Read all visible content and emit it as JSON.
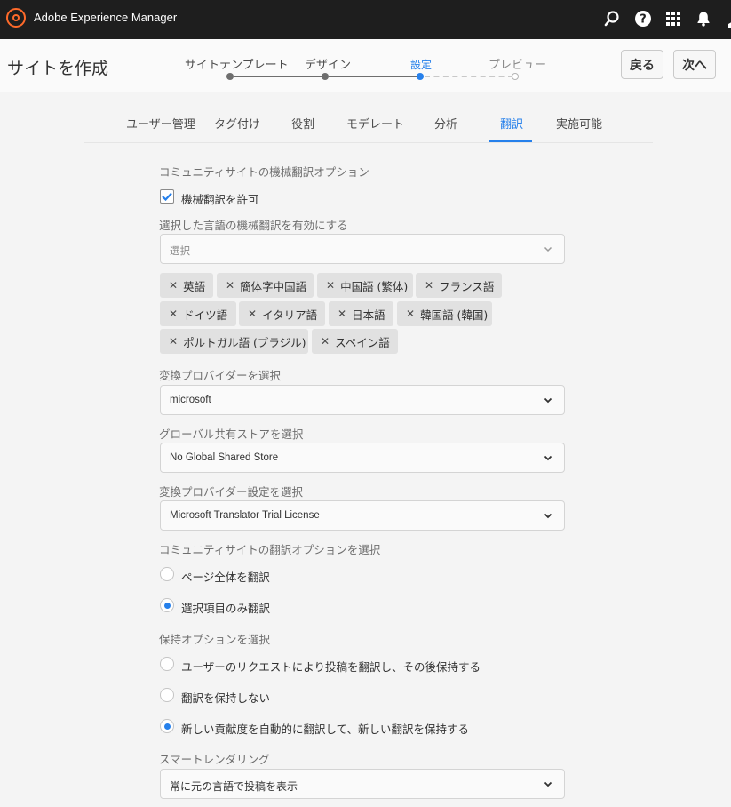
{
  "topbar": {
    "app_title": "Adobe Experience Manager",
    "icons": [
      "search-icon",
      "help-icon",
      "apps-icon",
      "bell-icon",
      "user-icon"
    ]
  },
  "header": {
    "page_title": "サイトを作成",
    "steps": [
      {
        "label": "サイトテンプレート",
        "state": "done"
      },
      {
        "label": "デザイン",
        "state": "done"
      },
      {
        "label": "設定",
        "state": "active"
      },
      {
        "label": "プレビュー",
        "state": "pending"
      }
    ],
    "back_label": "戻る",
    "next_label": "次へ"
  },
  "tabs": [
    {
      "label": "ユーザー管理"
    },
    {
      "label": "タグ付け"
    },
    {
      "label": "役割"
    },
    {
      "label": "モデレート"
    },
    {
      "label": "分析"
    },
    {
      "label": "翻訳",
      "active": true
    },
    {
      "label": "実施可能"
    }
  ],
  "form": {
    "mt_section_label": "コミュニティサイトの機械翻訳オプション",
    "allow_mt_label": "機械翻訳を許可",
    "allow_mt_checked": true,
    "languages_label": "選択した言語の機械翻訳を有効にする",
    "languages_placeholder": "選択",
    "language_tags": [
      "英語",
      "簡体字中国語",
      "中国語 (繁体)",
      "フランス語",
      "ドイツ語",
      "イタリア語",
      "日本語",
      "韓国語 (韓国)",
      "ポルトガル語 (ブラジル)",
      "スペイン語"
    ],
    "provider_label": "変換プロバイダーを選択",
    "provider_value": "microsoft",
    "store_label": "グローバル共有ストアを選択",
    "store_value": "No Global Shared Store",
    "provider_config_label": "変換プロバイダー設定を選択",
    "provider_config_value": "Microsoft Translator Trial License",
    "translate_options_label": "コミュニティサイトの翻訳オプションを選択",
    "translate_options": [
      {
        "label": "ページ全体を翻訳",
        "selected": false
      },
      {
        "label": "選択項目のみ翻訳",
        "selected": true
      }
    ],
    "persist_label": "保持オプションを選択",
    "persist_options": [
      {
        "label": "ユーザーのリクエストにより投稿を翻訳し、その後保持する",
        "selected": false
      },
      {
        "label": "翻訳を保持しない",
        "selected": false
      },
      {
        "label": "新しい貢献度を自動的に翻訳して、新しい翻訳を保持する",
        "selected": true
      }
    ],
    "smart_rendering_label": "スマートレンダリング",
    "smart_rendering_value": "常に元の言語で投稿を表示"
  },
  "colors": {
    "accent": "#2680eb",
    "topbar": "#1e1e1e",
    "brand": "#ff6a2a"
  }
}
